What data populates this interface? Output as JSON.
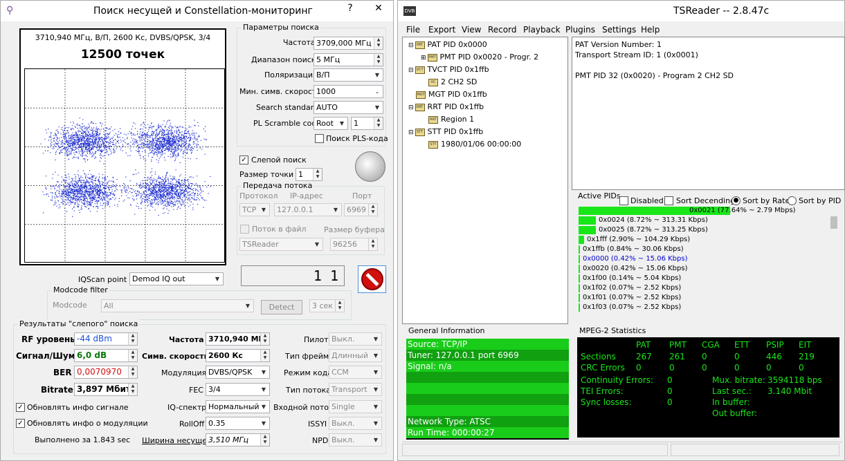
{
  "left": {
    "title": "Поиск несущей и Constellation-мониторинг",
    "close": "✕",
    "help": "?",
    "scan_header": "3710,940 МГц, В/П, 2600 Кс, DVBS/QPSK, 3/4",
    "points": "12500 точек",
    "params": {
      "group": "Параметры поиска",
      "freq_label": "Частота",
      "freq_value": "3709,000 МГц",
      "range_label": "Диапазон поиска",
      "range_value": "5 МГц",
      "pol_label": "Поляризация",
      "pol_value": "В/П",
      "minsym_label": "Мин. симв. скорость",
      "minsym_value": "1000",
      "std_label": "Search standard",
      "std_value": "AUTO",
      "pls_label": "PL Scramble code",
      "pls_mode": "Root",
      "pls_value": "1",
      "pls_search_label": "Поиск PLS-кода"
    },
    "blind_label": "Слепой поиск",
    "dot_size_label": "Размер точки",
    "dot_size_value": "1",
    "stream": {
      "group": "Передача потока",
      "proto_label": "Протокол",
      "ip_label": "IP-адрес",
      "port_label": "Порт",
      "proto_value": "TCP",
      "ip_value": "127.0.0.1",
      "port_value": "6969",
      "file_label": "Поток в файл",
      "buf_label": "Размер буфера",
      "app_value": "TSReader",
      "buf_value": "96256"
    },
    "counter": "1 1",
    "iqscan_label": "IQScan point",
    "iqscan_value": "Demod IQ out",
    "modcode": {
      "group": "Modcode filter",
      "label": "Modcode",
      "value": "All",
      "detect_label": "Detect",
      "time_value": "3 сек"
    },
    "results": {
      "group": "Результаты \"слепого\" поиска",
      "rf_label": "RF уровень",
      "rf_value": "-44 dBm",
      "snr_label": "Сигнал/Шум",
      "snr_value": "6,0 dB",
      "ber_label": "BER",
      "ber_value": "0,0070970",
      "bitrate_label": "Bitrate",
      "bitrate_value": "3,897 Мбит/",
      "freq_label": "Частота",
      "freq_value": "3710,940 МГц",
      "sym_label": "Симв. скорость",
      "sym_value": "2600 Кс",
      "mod_label": "Модуляция",
      "mod_value": "DVBS/QPSK",
      "fec_label": "FEC",
      "fec_value": "3/4",
      "iq_label": "IQ-спектр",
      "iq_value": "Нормальный",
      "rolloff_label": "RollOff",
      "rolloff_value": "0.35",
      "bw_label": "Ширина несущей",
      "bw_value": "3,510 МГц",
      "pilot_label": "Пилот",
      "pilot_value": "Выкл.",
      "frame_label": "Тип фрейма",
      "frame_value": "Длинный",
      "codemode_label": "Режим кода",
      "codemode_value": "CCM",
      "streamtype_label": "Тип потока",
      "streamtype_value": "Transport",
      "input_label": "Входной поток",
      "input_value": "Single",
      "issyi_label": "ISSYI",
      "issyi_value": "Выкл.",
      "npd_label": "NPD",
      "npd_value": "Выкл.",
      "upd_signal_label": "Обновлять инфо сигнале",
      "upd_mod_label": "Обновлять инфо о модуляции",
      "done_label": "Выполнено за 1.843 sec"
    }
  },
  "right": {
    "title": "TSReader -- 2.8.47c",
    "logo": "DVB",
    "menu": [
      "File",
      "Export",
      "View",
      "Record",
      "Playback",
      "Plugins",
      "Settings",
      "Help"
    ],
    "tree": [
      "PAT PID 0x0000",
      "PMT PID 0x0020 - Progr. 2",
      "TVCT PID 0x1ffb",
      "2 CH2 SD",
      "MGT PID 0x1ffb",
      "RRT PID 0x1ffb",
      "Region 1",
      "STT PID 0x1ffb",
      "1980/01/06 00:00:00"
    ],
    "tree_icons": [
      "PAT",
      "PMT",
      "VCT",
      "VC",
      "MGT",
      "RRT",
      "RRT",
      "STT",
      "STT"
    ],
    "details": [
      "PAT Version Number: 1",
      "Transport Stream ID: 1 (0x0001)",
      "",
      "PMT PID 32 (0x0020) - Program 2 CH2 SD"
    ],
    "active_pids_label": "Active PIDs",
    "opt_disabled": "Disabled",
    "opt_sortdesc": "Sort Decending",
    "opt_sortrate": "Sort by Rate",
    "opt_sortpid": "Sort by PID",
    "pids": [
      {
        "label": "0x0021 (77.64% ~ 2.79 Mbps)",
        "pct": 77.64,
        "color": "#000000"
      },
      {
        "label": "0x0024 (8.72% ~ 313.31 Kbps)",
        "pct": 8.72,
        "color": "#000000"
      },
      {
        "label": "0x0025 (8.72% ~ 313.25 Kbps)",
        "pct": 8.72,
        "color": "#000000"
      },
      {
        "label": "0x1fff (2.90% ~ 104.29 Kbps)",
        "pct": 2.9,
        "color": "#000000"
      },
      {
        "label": "0x1ffb (0.84% ~ 30.06 Kbps)",
        "pct": 0.84,
        "color": "#000000"
      },
      {
        "label": "0x0000 (0.42% ~ 15.06 Kbps)",
        "pct": 0.42,
        "color": "#0000cc"
      },
      {
        "label": "0x0020 (0.42% ~ 15.06 Kbps)",
        "pct": 0.42,
        "color": "#000000"
      },
      {
        "label": "0x1f00 (0.14% ~ 5.04 Kbps)",
        "pct": 0.14,
        "color": "#000000"
      },
      {
        "label": "0x1f02 (0.07% ~ 2.52 Kbps)",
        "pct": 0.07,
        "color": "#000000"
      },
      {
        "label": "0x1f01 (0.07% ~ 2.52 Kbps)",
        "pct": 0.07,
        "color": "#000000"
      },
      {
        "label": "0x1f03 (0.07% ~ 2.52 Kbps)",
        "pct": 0.07,
        "color": "#000000"
      }
    ],
    "general_info_label": "General Information",
    "general_info": [
      "Source: TCP/IP",
      "Tuner: 127.0.0.1 port 6969",
      "Signal: n/a",
      "",
      "",
      "",
      "",
      "Network Type: ATSC",
      "Run Time: 000:00:27"
    ],
    "mpeg_label": "MPEG-2 Statistics",
    "mpeg": {
      "cols": [
        "PAT",
        "PMT",
        "CGA",
        "ETT",
        "PSIP",
        "EIT"
      ],
      "sections_label": "Sections",
      "sections": [
        "267",
        "261",
        "0",
        "0",
        "446",
        "219"
      ],
      "crc_label": "CRC Errors",
      "crc": [
        "0",
        "0",
        "0",
        "0",
        "0",
        "0"
      ],
      "cont_label": "Continuity Errors:",
      "cont": "0",
      "tei_label": "TEI Errors:",
      "tei": "0",
      "sync_label": "Sync losses:",
      "sync": "0",
      "mux_label": "Mux. bitrate:",
      "mux": "3594118 bps",
      "last_label": "Last sec.:",
      "last": "3.140 Mbit",
      "inbuf_label": "In buffer:",
      "outbuf_label": "Out buffer:"
    }
  }
}
